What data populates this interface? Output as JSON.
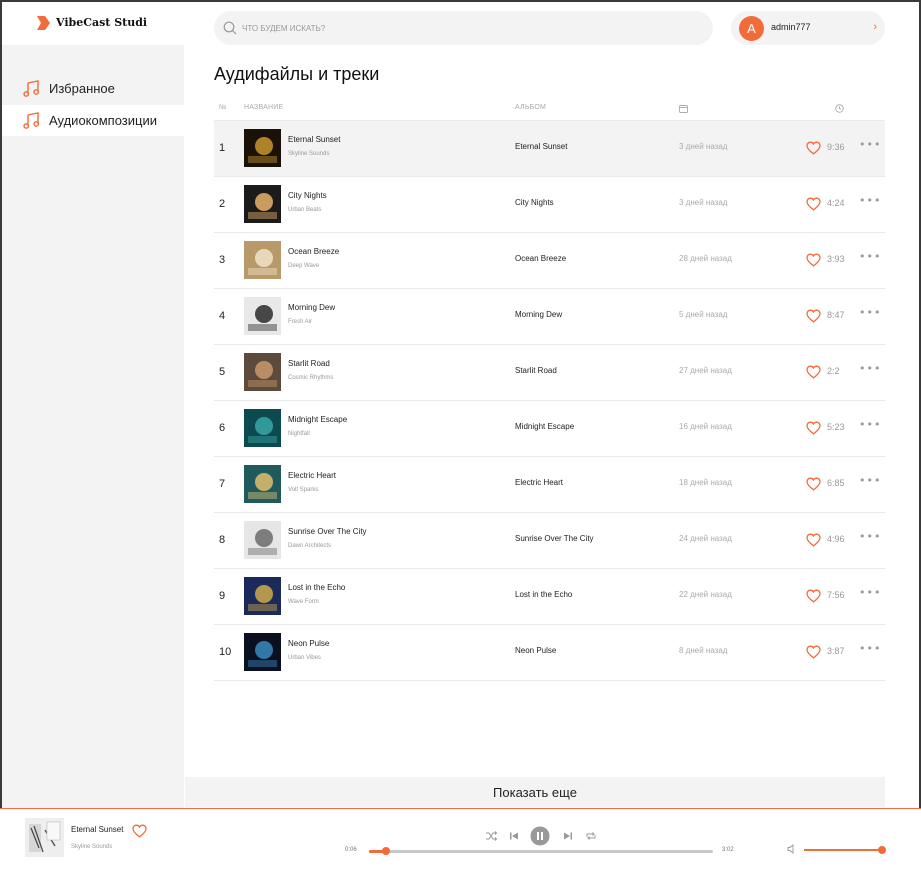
{
  "app": {
    "brand": "VibeCast Studi"
  },
  "colors": {
    "accent": "#f26b3a",
    "sidebar_bg": "#f3f3f3",
    "muted": "#999999"
  },
  "sidebar": {
    "items": [
      {
        "label": "Избранное",
        "icon": "music-note-icon"
      },
      {
        "label": "Аудиокомпозиции",
        "icon": "music-note-icon",
        "active": true
      }
    ]
  },
  "header": {
    "search_placeholder": "ЧТО БУДЕМ ИСКАТЬ?",
    "user": {
      "avatar_letter": "A",
      "name": "admin777",
      "chevron": "›"
    }
  },
  "page": {
    "title": "Аудифайлы и треки"
  },
  "table": {
    "columns": {
      "num": "№",
      "name": "НАЗВАНИЕ",
      "album": "АЛЬБОМ",
      "date_icon": "calendar-icon",
      "duration_icon": "clock-icon"
    },
    "rows": [
      {
        "num": "1",
        "title": "Eternal Sunset",
        "artist": "Skyline Sounds",
        "album": "Eternal Sunset",
        "date": "3 дней назад",
        "duration": "9:36",
        "cover_colors": [
          "#1a1208",
          "#c9962e"
        ]
      },
      {
        "num": "2",
        "title": "City Nights",
        "artist": "Urban Beats",
        "album": "City Nights",
        "date": "3 дней назад",
        "duration": "4:24",
        "cover_colors": [
          "#1b1b1b",
          "#e8b26a"
        ]
      },
      {
        "num": "3",
        "title": "Ocean Breeze",
        "artist": "Deep Wave",
        "album": "Ocean Breeze",
        "date": "28 дней назад",
        "duration": "3:93",
        "cover_colors": [
          "#b89a6a",
          "#f0e2c6"
        ]
      },
      {
        "num": "4",
        "title": "Morning Dew",
        "artist": "Fresh Air",
        "album": "Morning Dew",
        "date": "5 дней назад",
        "duration": "8:47",
        "cover_colors": [
          "#e8e8e8",
          "#2a2a2a"
        ]
      },
      {
        "num": "5",
        "title": "Starlit Road",
        "artist": "Cosmic Rhythms",
        "album": "Starlit Road",
        "date": "27 дней назад",
        "duration": "2:2",
        "cover_colors": [
          "#5c4a3a",
          "#c79a6b"
        ]
      },
      {
        "num": "6",
        "title": "Midnight Escape",
        "artist": "Nightfall",
        "album": "Midnight Escape",
        "date": "16 дней назад",
        "duration": "5:23",
        "cover_colors": [
          "#0d4a4f",
          "#3aa7a8"
        ]
      },
      {
        "num": "7",
        "title": "Electric Heart",
        "artist": "Volt Sparks",
        "album": "Electric Heart",
        "date": "18 дней назад",
        "duration": "6:85",
        "cover_colors": [
          "#1f5a5c",
          "#e0c070"
        ]
      },
      {
        "num": "8",
        "title": "Sunrise Over The City",
        "artist": "Dawn Architects",
        "album": "Sunrise Over The City",
        "date": "24 дней назад",
        "duration": "4:96",
        "cover_colors": [
          "#e6e6e6",
          "#6a6a6a"
        ]
      },
      {
        "num": "9",
        "title": "Lost in the Echo",
        "artist": "Wave Form",
        "album": "Lost in the Echo",
        "date": "22 дней назад",
        "duration": "7:56",
        "cover_colors": [
          "#1a2a5a",
          "#d0a94a"
        ]
      },
      {
        "num": "10",
        "title": "Neon Pulse",
        "artist": "Urban Vibes",
        "album": "Neon Pulse",
        "date": "8 дней назад",
        "duration": "3:87",
        "cover_colors": [
          "#0a1020",
          "#3a8ac0"
        ]
      }
    ]
  },
  "show_more_label": "Показать еще",
  "player": {
    "title": "Eternal Sunset",
    "artist": "Skyline Sounds",
    "current_time": "0:06",
    "total_time": "3:02",
    "progress_fraction": 0.05,
    "volume_fraction": 1.0
  }
}
